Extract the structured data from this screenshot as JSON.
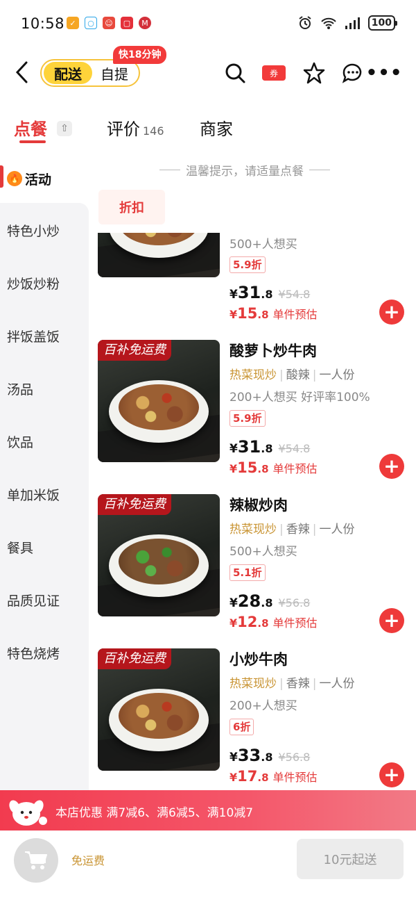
{
  "status_bar": {
    "time": "10:58",
    "battery": "100",
    "network": "6"
  },
  "header": {
    "mode_active": "配送",
    "mode_inactive": "自提",
    "fast_tag": "快18分钟",
    "coupon_label": "券"
  },
  "tabs": [
    {
      "label": "点餐",
      "active": true
    },
    {
      "label": "评价",
      "count": "146"
    },
    {
      "label": "商家"
    }
  ],
  "sidebar": {
    "active": "活动",
    "items": [
      "特色小炒",
      "炒饭炒粉",
      "拌饭盖饭",
      "汤品",
      "饮品",
      "单加米饭",
      "餐具",
      "品质见证",
      "特色烧烤"
    ]
  },
  "tip": "温馨提示，请适量点餐",
  "section_title": "折扣",
  "items": [
    {
      "name": "",
      "sales": "500+人想买",
      "discount": "5.9折",
      "price_int": "31",
      "price_dec": ".8",
      "orig_price": "¥54.8",
      "est_int": "15",
      "est_dec": ".8",
      "est_label": "单件预估"
    },
    {
      "promo": "百补免运费",
      "name": "酸萝卜炒牛肉",
      "tag_hot": "热菜现炒",
      "tag_taste": "酸辣",
      "tag_size": "一人份",
      "sales": "200+人想买  好评率100%",
      "discount": "5.9折",
      "price_int": "31",
      "price_dec": ".8",
      "orig_price": "¥54.8",
      "est_int": "15",
      "est_dec": ".8",
      "est_label": "单件预估"
    },
    {
      "promo": "百补免运费",
      "name": "辣椒炒肉",
      "tag_hot": "热菜现炒",
      "tag_taste": "香辣",
      "tag_size": "一人份",
      "sales": "500+人想买",
      "discount": "5.1折",
      "price_int": "28",
      "price_dec": ".8",
      "orig_price": "¥56.8",
      "est_int": "12",
      "est_dec": ".8",
      "est_label": "单件预估"
    },
    {
      "promo": "百补免运费",
      "name": "小炒牛肉",
      "tag_hot": "热菜现炒",
      "tag_taste": "香辣",
      "tag_size": "一人份",
      "sales": "200+人想买",
      "discount": "6折",
      "price_int": "33",
      "price_dec": ".8",
      "orig_price": "¥56.8",
      "est_int": "17",
      "est_dec": ".8",
      "est_label": "单件预估"
    }
  ],
  "currency": "¥",
  "promo_bar": "本店优惠  满7减6、满6减5、满10减7",
  "bottom": {
    "free_delivery": "免运费",
    "min_order": "10元起送"
  },
  "colors": {
    "accent_red": "#e43a3a",
    "yellow": "#fed33a",
    "gold_tag": "#c99433"
  }
}
